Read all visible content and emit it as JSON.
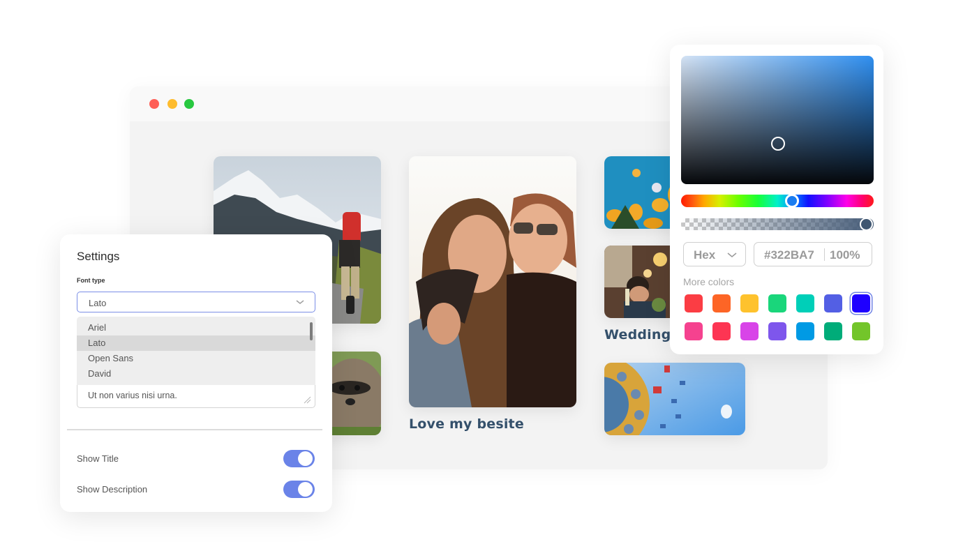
{
  "browser": {
    "window_controls": [
      "close",
      "minimize",
      "maximize"
    ],
    "control_colors": {
      "close": "#fe5f57",
      "minimize": "#febc2e",
      "maximize": "#28c840"
    }
  },
  "gallery": {
    "captions": {
      "center": "Love my besite",
      "right": "Wedding"
    },
    "photos": [
      {
        "subject": "hiker-mountains"
      },
      {
        "subject": "raccoon"
      },
      {
        "subject": "two-friends-hugging"
      },
      {
        "subject": "yellow-flowers"
      },
      {
        "subject": "wedding-party"
      },
      {
        "subject": "swing-ride"
      }
    ]
  },
  "settings": {
    "title": "Settings",
    "font_type_label": "Font type",
    "font_select_value": "Lato",
    "font_options": [
      "Ariel",
      "Lato",
      "Open Sans",
      "David"
    ],
    "font_selected_index": 1,
    "description_value": "Ut non varius nisi urna.",
    "toggles": [
      {
        "label": "Show Title",
        "on": true
      },
      {
        "label": "Show Description",
        "on": true
      }
    ],
    "accent_color": "#6a83e8"
  },
  "color_picker": {
    "format": "Hex",
    "hex_value": "#322BA7",
    "alpha_value": "100%",
    "more_colors_label": "More colors",
    "swatches": [
      "#fb3d44",
      "#fd6526",
      "#fec22d",
      "#1ad67b",
      "#00cfb8",
      "#535fe4",
      "#1e00ff",
      "#f5428f",
      "#fd3553",
      "#d844e8",
      "#7e56ec",
      "#009ae4",
      "#00ac79",
      "#73c52a"
    ],
    "active_swatch_index": 6
  }
}
